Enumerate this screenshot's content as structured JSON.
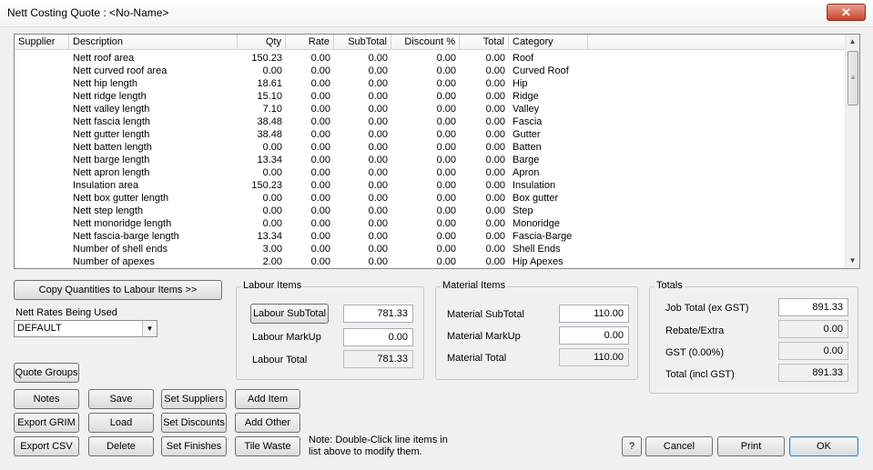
{
  "window": {
    "title": "Nett Costing   Quote : <No-Name>",
    "close_label": "✕"
  },
  "list": {
    "columns": [
      "Supplier",
      "Description",
      "Qty",
      "Rate",
      "SubTotal",
      "Discount %",
      "Total",
      "Category"
    ],
    "rows": [
      [
        "",
        "Nett roof area",
        "150.23",
        "0.00",
        "0.00",
        "0.00",
        "0.00",
        "Roof"
      ],
      [
        "",
        "Nett curved roof area",
        "0.00",
        "0.00",
        "0.00",
        "0.00",
        "0.00",
        "Curved Roof"
      ],
      [
        "",
        "Nett hip length",
        "18.61",
        "0.00",
        "0.00",
        "0.00",
        "0.00",
        "Hip"
      ],
      [
        "",
        "Nett ridge length",
        "15.10",
        "0.00",
        "0.00",
        "0.00",
        "0.00",
        "Ridge"
      ],
      [
        "",
        "Nett valley length",
        "7.10",
        "0.00",
        "0.00",
        "0.00",
        "0.00",
        "Valley"
      ],
      [
        "",
        "Nett fascia length",
        "38.48",
        "0.00",
        "0.00",
        "0.00",
        "0.00",
        "Fascia"
      ],
      [
        "",
        "Nett gutter length",
        "38.48",
        "0.00",
        "0.00",
        "0.00",
        "0.00",
        "Gutter"
      ],
      [
        "",
        "Nett batten length",
        "0.00",
        "0.00",
        "0.00",
        "0.00",
        "0.00",
        "Batten"
      ],
      [
        "",
        "Nett barge length",
        "13.34",
        "0.00",
        "0.00",
        "0.00",
        "0.00",
        "Barge"
      ],
      [
        "",
        "Nett apron length",
        "0.00",
        "0.00",
        "0.00",
        "0.00",
        "0.00",
        "Apron"
      ],
      [
        "",
        "Insulation area",
        "150.23",
        "0.00",
        "0.00",
        "0.00",
        "0.00",
        "Insulation"
      ],
      [
        "",
        "Nett box gutter length",
        "0.00",
        "0.00",
        "0.00",
        "0.00",
        "0.00",
        "Box gutter"
      ],
      [
        "",
        "Nett step length",
        "0.00",
        "0.00",
        "0.00",
        "0.00",
        "0.00",
        "Step"
      ],
      [
        "",
        "Nett monoridge length",
        "0.00",
        "0.00",
        "0.00",
        "0.00",
        "0.00",
        "Monoridge"
      ],
      [
        "",
        "Nett fascia-barge length",
        "13.34",
        "0.00",
        "0.00",
        "0.00",
        "0.00",
        "Fascia-Barge"
      ],
      [
        "",
        "Number of shell ends",
        "3.00",
        "0.00",
        "0.00",
        "0.00",
        "0.00",
        "Shell Ends"
      ],
      [
        "",
        "Number of apexes",
        "2.00",
        "0.00",
        "0.00",
        "0.00",
        "0.00",
        "Hip Apexes"
      ]
    ]
  },
  "left": {
    "copy_button": "Copy Quantities to Labour Items >>",
    "rates_label": "Nett Rates Being Used",
    "rates_value": "DEFAULT",
    "quote_groups": "Quote Groups"
  },
  "labour": {
    "legend": "Labour Items",
    "subtotal_button": "Labour SubTotal",
    "subtotal": "781.33",
    "markup_label": "Labour MarkUp",
    "markup": "0.00",
    "total_label": "Labour Total",
    "total": "781.33"
  },
  "material": {
    "legend": "Material Items",
    "subtotal_label": "Material SubTotal",
    "subtotal": "110.00",
    "markup_label": "Material MarkUp",
    "markup": "0.00",
    "total_label": "Material Total",
    "total": "110.00"
  },
  "totals": {
    "legend": "Totals",
    "job_label": "Job Total (ex GST)",
    "job": "891.33",
    "rebate_label": "Rebate/Extra",
    "rebate": "0.00",
    "gst_label": "GST (0.00%)",
    "gst": "0.00",
    "total_label": "Total (incl GST)",
    "total": "891.33"
  },
  "buttons": {
    "notes": "Notes",
    "save": "Save",
    "set_suppliers": "Set Suppliers",
    "add_item": "Add Item",
    "export_grim": "Export GRIM",
    "load": "Load",
    "set_discounts": "Set Discounts",
    "add_other": "Add Other",
    "export_csv": "Export CSV",
    "delete": "Delete",
    "set_finishes": "Set Finishes",
    "tile_waste": "Tile Waste",
    "help": "?",
    "cancel": "Cancel",
    "print": "Print",
    "ok": "OK"
  },
  "note": "Note: Double-Click line items in list above to modify them."
}
